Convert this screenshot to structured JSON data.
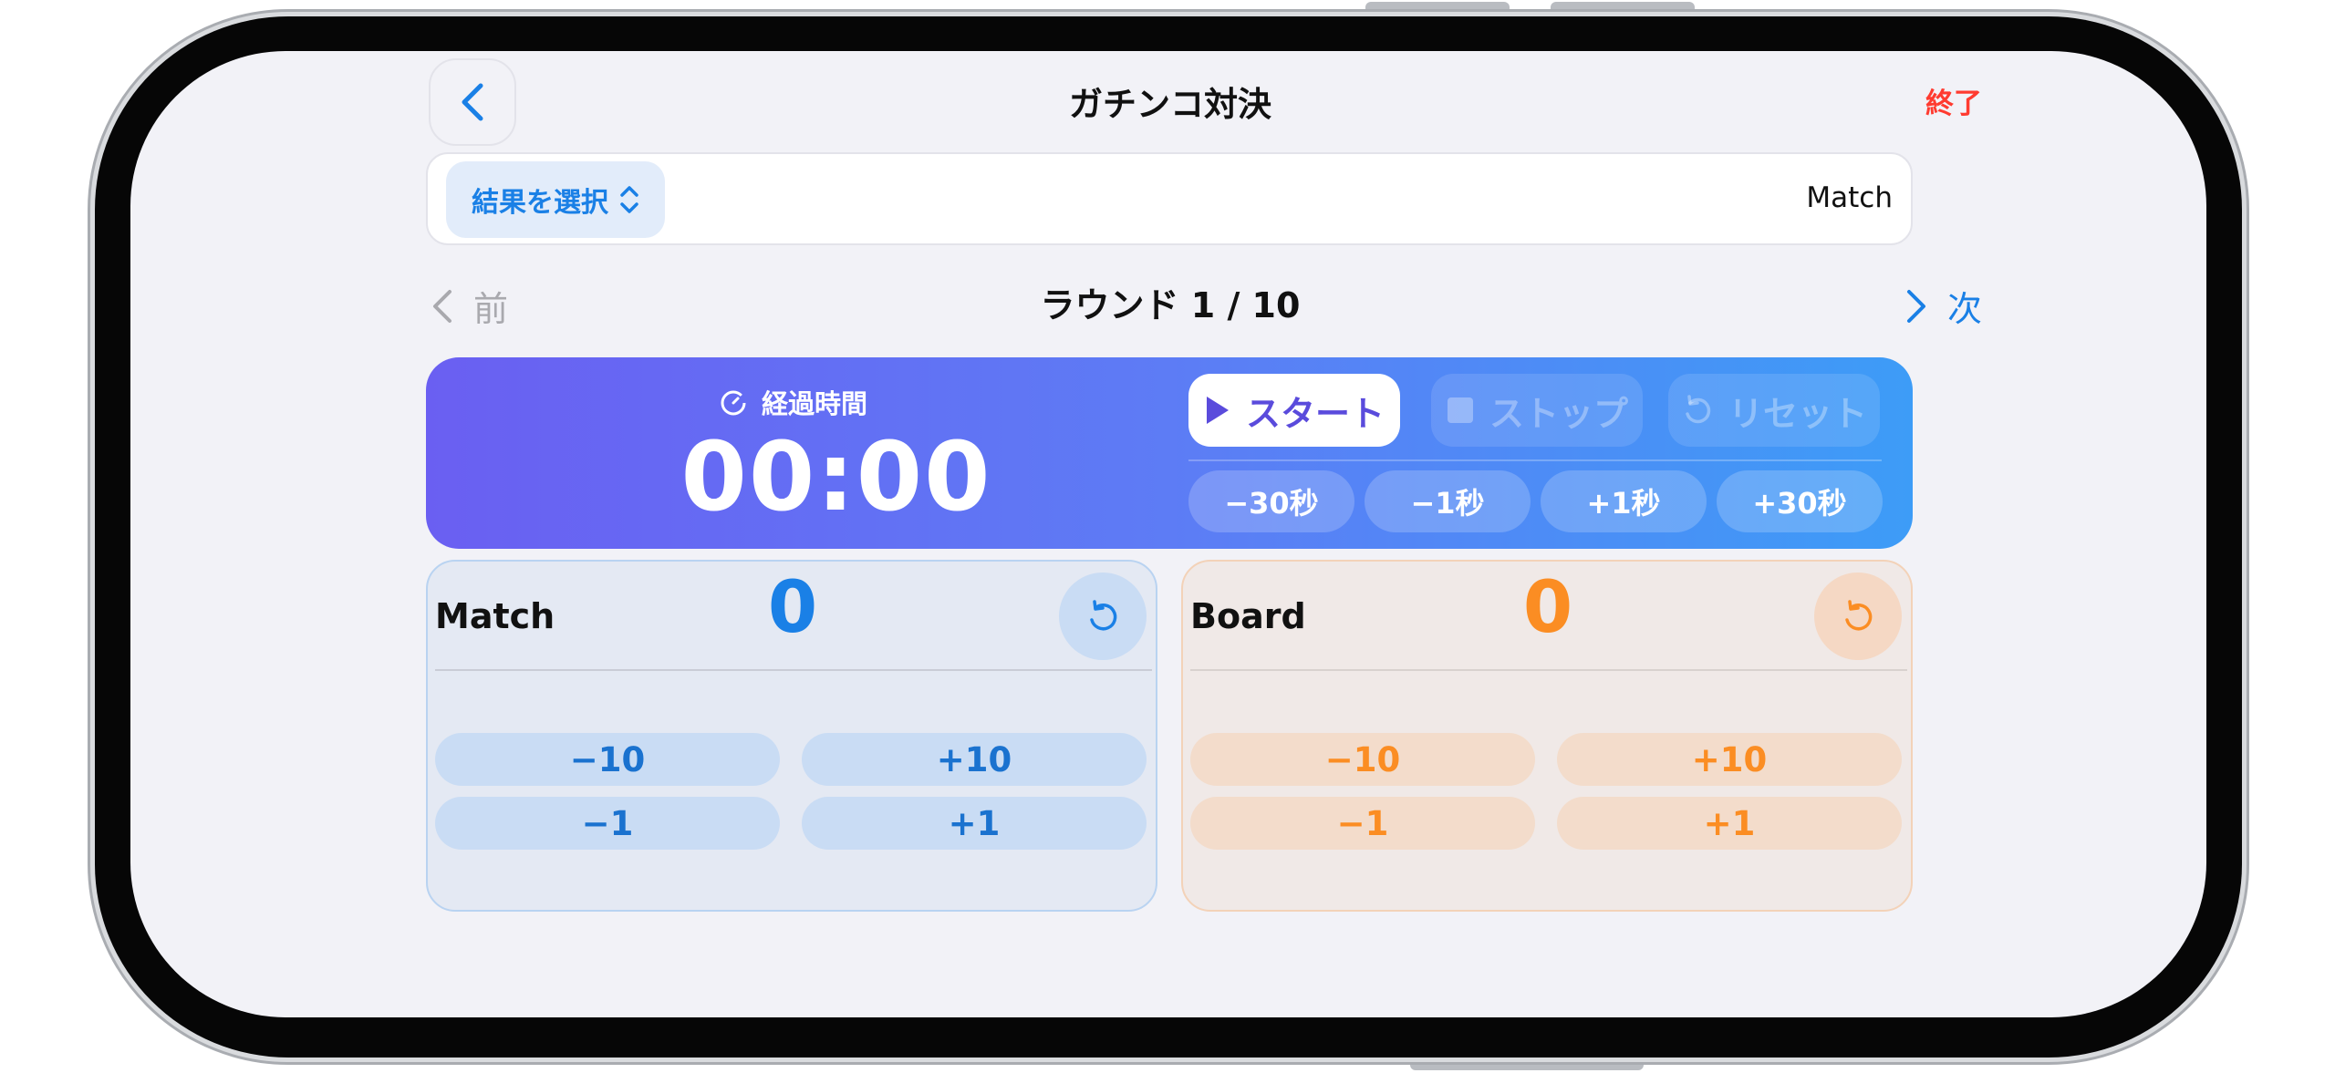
{
  "nav": {
    "title": "ガチンコ対決",
    "end_label": "終了"
  },
  "result_bar": {
    "select_label": "結果を選択",
    "match_label": "Match"
  },
  "round_nav": {
    "prev_label": "前",
    "round_label": "ラウンド 1 / 10",
    "next_label": "次"
  },
  "timer": {
    "caption": "経過時間",
    "value": "00:00",
    "start_label": "スタート",
    "stop_label": "ストップ",
    "reset_label": "リセット",
    "adjust": [
      "−30秒",
      "−1秒",
      "+1秒",
      "+30秒"
    ]
  },
  "players": [
    {
      "name": "Match",
      "score": "0",
      "buttons": [
        "−10",
        "+10",
        "−1",
        "+1"
      ],
      "color": "#1a80e6"
    },
    {
      "name": "Board",
      "score": "0",
      "buttons": [
        "−10",
        "+10",
        "−1",
        "+1"
      ],
      "color": "#fb8d23"
    }
  ]
}
